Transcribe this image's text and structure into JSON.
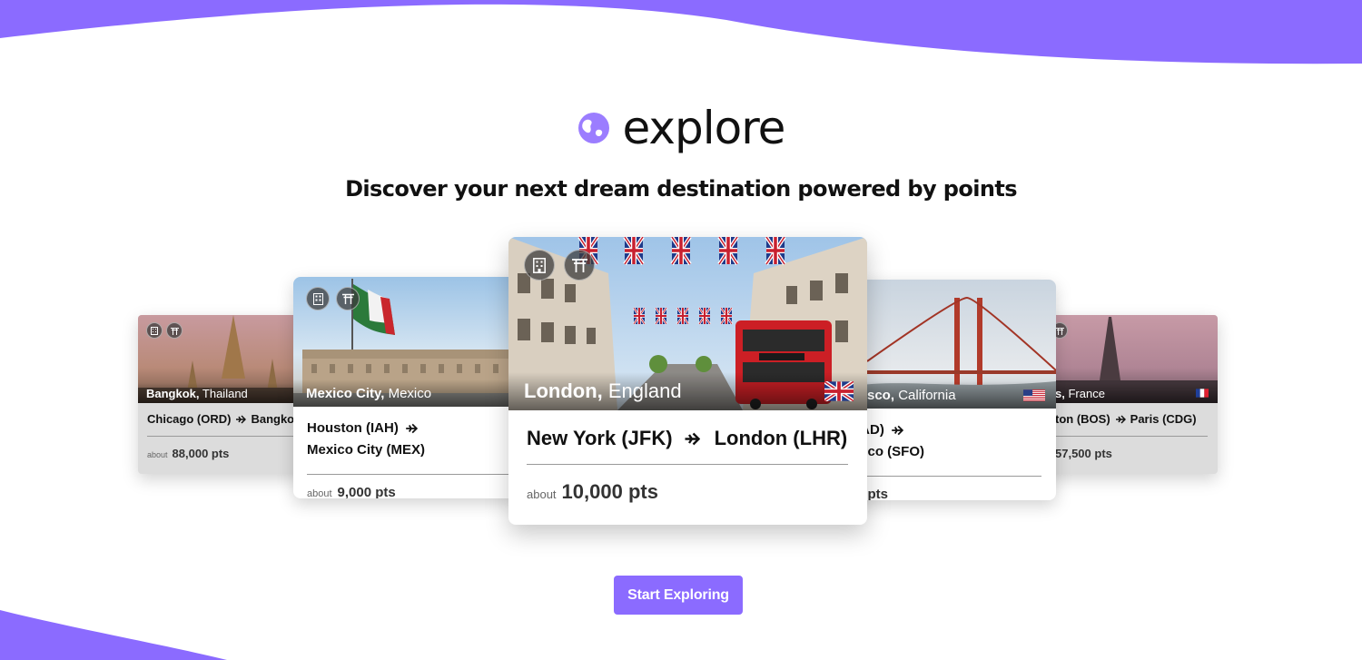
{
  "brand": {
    "name": "explore",
    "icon": "globe-icon",
    "accent": "#8b6bff"
  },
  "tagline": "Discover your next dream destination powered by points",
  "cards": [
    {
      "city": "Bangkok,",
      "region": "Thailand",
      "from": "Chicago (ORD)",
      "to": "Bangkok",
      "about": "about",
      "points": "88,000 pts",
      "flag": ""
    },
    {
      "city": "Mexico City,",
      "region": "Mexico",
      "from": "Houston (IAH)",
      "to": "Mexico City (MEX)",
      "about": "about",
      "points": "9,000 pts",
      "flag": ""
    },
    {
      "city": "London,",
      "region": "England",
      "from": "New York (JFK)",
      "to": "London (LHR)",
      "about": "about",
      "points": "10,000 pts",
      "flag": "uk-flag-icon"
    },
    {
      "city": "sco,",
      "region": "California",
      "from": "IAD)",
      "to": "isco (SFO)",
      "about": "",
      "points": "0 pts",
      "flag": "us-flag-icon"
    },
    {
      "city": "s,",
      "region": "France",
      "from": "ton (BOS)",
      "to": "Paris (CDG)",
      "about": "",
      "points": "57,500 pts",
      "flag": "france-flag-icon"
    }
  ],
  "cta": {
    "label": "Start Exploring"
  }
}
